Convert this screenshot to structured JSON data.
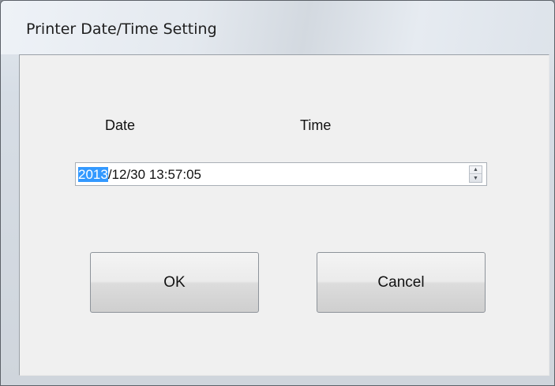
{
  "window": {
    "title": "Printer Date/Time Setting"
  },
  "labels": {
    "date": "Date",
    "time": "Time"
  },
  "datetime": {
    "selected_part": "2013",
    "rest": "/12/30 13:57:05",
    "spin_up_icon": "▲",
    "spin_down_icon": "▼"
  },
  "buttons": {
    "ok": "OK",
    "cancel": "Cancel"
  },
  "colors": {
    "selection": "#3399ff",
    "client_bg": "#f0f0f0"
  }
}
